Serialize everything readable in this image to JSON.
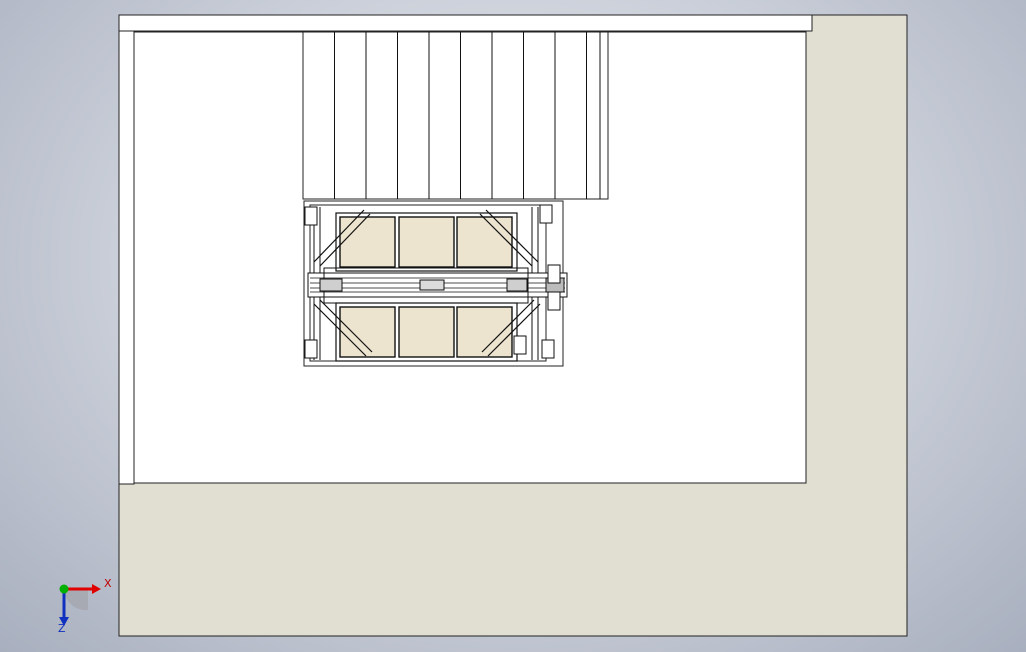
{
  "viewport": {
    "background_center": "#e9ecf1",
    "background_edge": "#a8afbe"
  },
  "model": {
    "floor_color": "#e0dfd1",
    "wall_color": "#ffffff",
    "edge_color": "#111111",
    "tile_color": "#ede4cf",
    "wall_planks": 10,
    "tiles_per_row": 3,
    "tile_rows": 2
  },
  "triad": {
    "x_label": "X",
    "z_label": "Z",
    "x_color": "#e00000",
    "y_color": "#00b000",
    "z_color": "#1030c0"
  }
}
